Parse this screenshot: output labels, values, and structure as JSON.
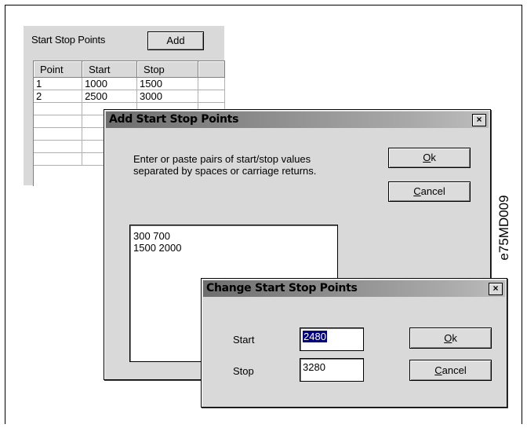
{
  "start_stop_panel": {
    "label": "Start Stop Points",
    "add_label": "Add",
    "columns": [
      "Point",
      "Start",
      "Stop",
      ""
    ],
    "rows": [
      [
        "1",
        "1000",
        "1500",
        ""
      ],
      [
        "2",
        "2500",
        "3000",
        ""
      ],
      [
        "",
        "",
        "",
        ""
      ],
      [
        "",
        "",
        "",
        ""
      ],
      [
        "",
        "",
        "",
        ""
      ],
      [
        "",
        "",
        "",
        ""
      ],
      [
        "",
        "",
        "",
        ""
      ]
    ]
  },
  "add_dialog": {
    "title": "Add Start Stop Points",
    "close_glyph": "×",
    "instructions": "Enter or paste pairs of start/stop values separated by spaces or carriage returns.",
    "ok_label": "Ok",
    "ok_accel": "O",
    "ok_rest": "k",
    "cancel_label": "Cancel",
    "cancel_accel": "C",
    "cancel_rest": "ancel",
    "text_value": "300 700\n1500 2000"
  },
  "change_dialog": {
    "title": "Change Start Stop Points",
    "close_glyph": "×",
    "start_label": "Start",
    "start_value": "2480",
    "stop_label": "Stop",
    "stop_value": "3280",
    "ok_label": "Ok",
    "ok_accel": "O",
    "ok_rest": "k",
    "cancel_label": "Cancel",
    "cancel_accel": "C",
    "cancel_rest": "ancel"
  },
  "figure_code": "e75MD009"
}
